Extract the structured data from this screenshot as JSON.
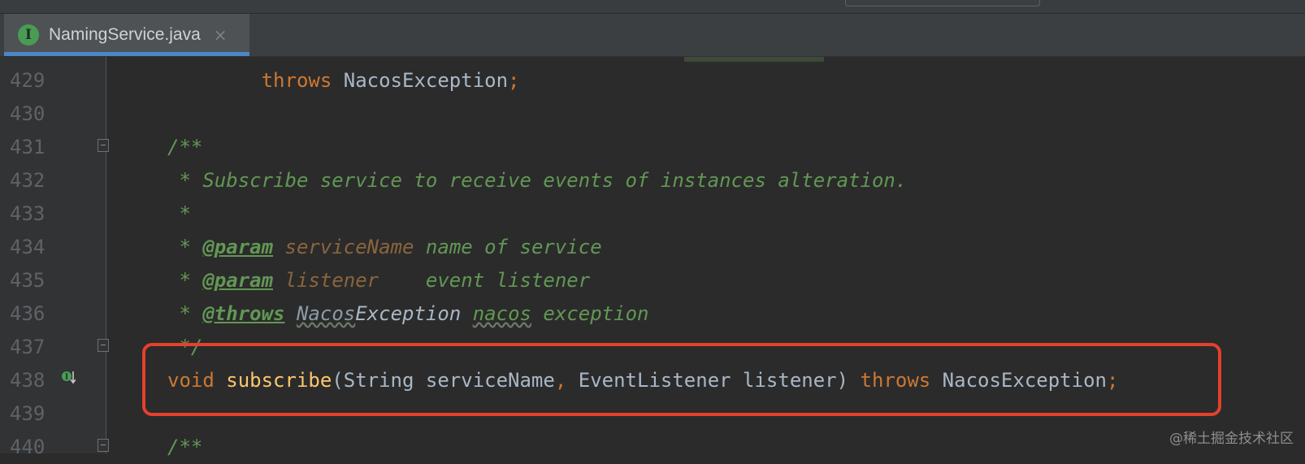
{
  "tabs": [
    {
      "label": "NamingService.java",
      "icon": "interface-icon",
      "icon_letter": "I",
      "close": "×"
    }
  ],
  "lines": [
    {
      "num": "429",
      "tokens": [
        {
          "t": "        ",
          "c": "plain"
        },
        {
          "t": "throws",
          "c": "kw"
        },
        {
          "t": " NacosException",
          "c": "plain"
        },
        {
          "t": ";",
          "c": "kw"
        }
      ]
    },
    {
      "num": "430",
      "tokens": []
    },
    {
      "num": "431",
      "tokens": [
        {
          "t": "/**",
          "c": "cm"
        }
      ]
    },
    {
      "num": "432",
      "tokens": [
        {
          "t": " * Subscribe service to receive events of instances alteration.",
          "c": "cm"
        }
      ]
    },
    {
      "num": "433",
      "tokens": [
        {
          "t": " *",
          "c": "cm"
        }
      ]
    },
    {
      "num": "434",
      "tokens": [
        {
          "t": " * ",
          "c": "cm"
        },
        {
          "t": "@param",
          "c": "tag"
        },
        {
          "t": " ",
          "c": "cm"
        },
        {
          "t": "serviceName",
          "c": "pname"
        },
        {
          "t": " name of service",
          "c": "cm"
        }
      ]
    },
    {
      "num": "435",
      "tokens": [
        {
          "t": " * ",
          "c": "cm"
        },
        {
          "t": "@param",
          "c": "tag"
        },
        {
          "t": " ",
          "c": "cm"
        },
        {
          "t": "listener",
          "c": "pname"
        },
        {
          "t": "    event listener",
          "c": "cm"
        }
      ]
    },
    {
      "num": "436",
      "tokens": [
        {
          "t": " * ",
          "c": "cm"
        },
        {
          "t": "@throws",
          "c": "tag"
        },
        {
          "t": " ",
          "c": "cm"
        },
        {
          "t": "Nacos",
          "c": "ref"
        },
        {
          "t": "Exception",
          "c": "plain-italic"
        },
        {
          "t": " ",
          "c": "cm"
        },
        {
          "t": "nacos",
          "c": "refc"
        },
        {
          "t": " exception",
          "c": "cm"
        }
      ]
    },
    {
      "num": "437",
      "tokens": [
        {
          "t": " */",
          "c": "cm"
        }
      ]
    },
    {
      "num": "438",
      "tokens": [
        {
          "t": "void",
          "c": "kw"
        },
        {
          "t": " ",
          "c": "plain"
        },
        {
          "t": "subscribe",
          "c": "fn"
        },
        {
          "t": "(String serviceName",
          "c": "plain"
        },
        {
          "t": ",",
          "c": "kw"
        },
        {
          "t": " EventListener listener) ",
          "c": "plain"
        },
        {
          "t": "throws",
          "c": "kw"
        },
        {
          "t": " NacosException",
          "c": "plain"
        },
        {
          "t": ";",
          "c": "kw"
        }
      ]
    },
    {
      "num": "439",
      "tokens": []
    },
    {
      "num": "440",
      "tokens": [
        {
          "t": "/**",
          "c": "cm"
        }
      ]
    }
  ],
  "gutter_icons": [
    {
      "line": "438",
      "icon": "implemented-method-icon"
    }
  ],
  "highlight": {
    "line": "438",
    "color": "#e4402c"
  },
  "watermark": "@稀土掘金技术社区",
  "colors": {
    "background": "#2b2b2b",
    "keyword": "#cc7832",
    "method": "#ffc66d",
    "comment": "#629755",
    "tab_underline": "#4a88c7"
  }
}
